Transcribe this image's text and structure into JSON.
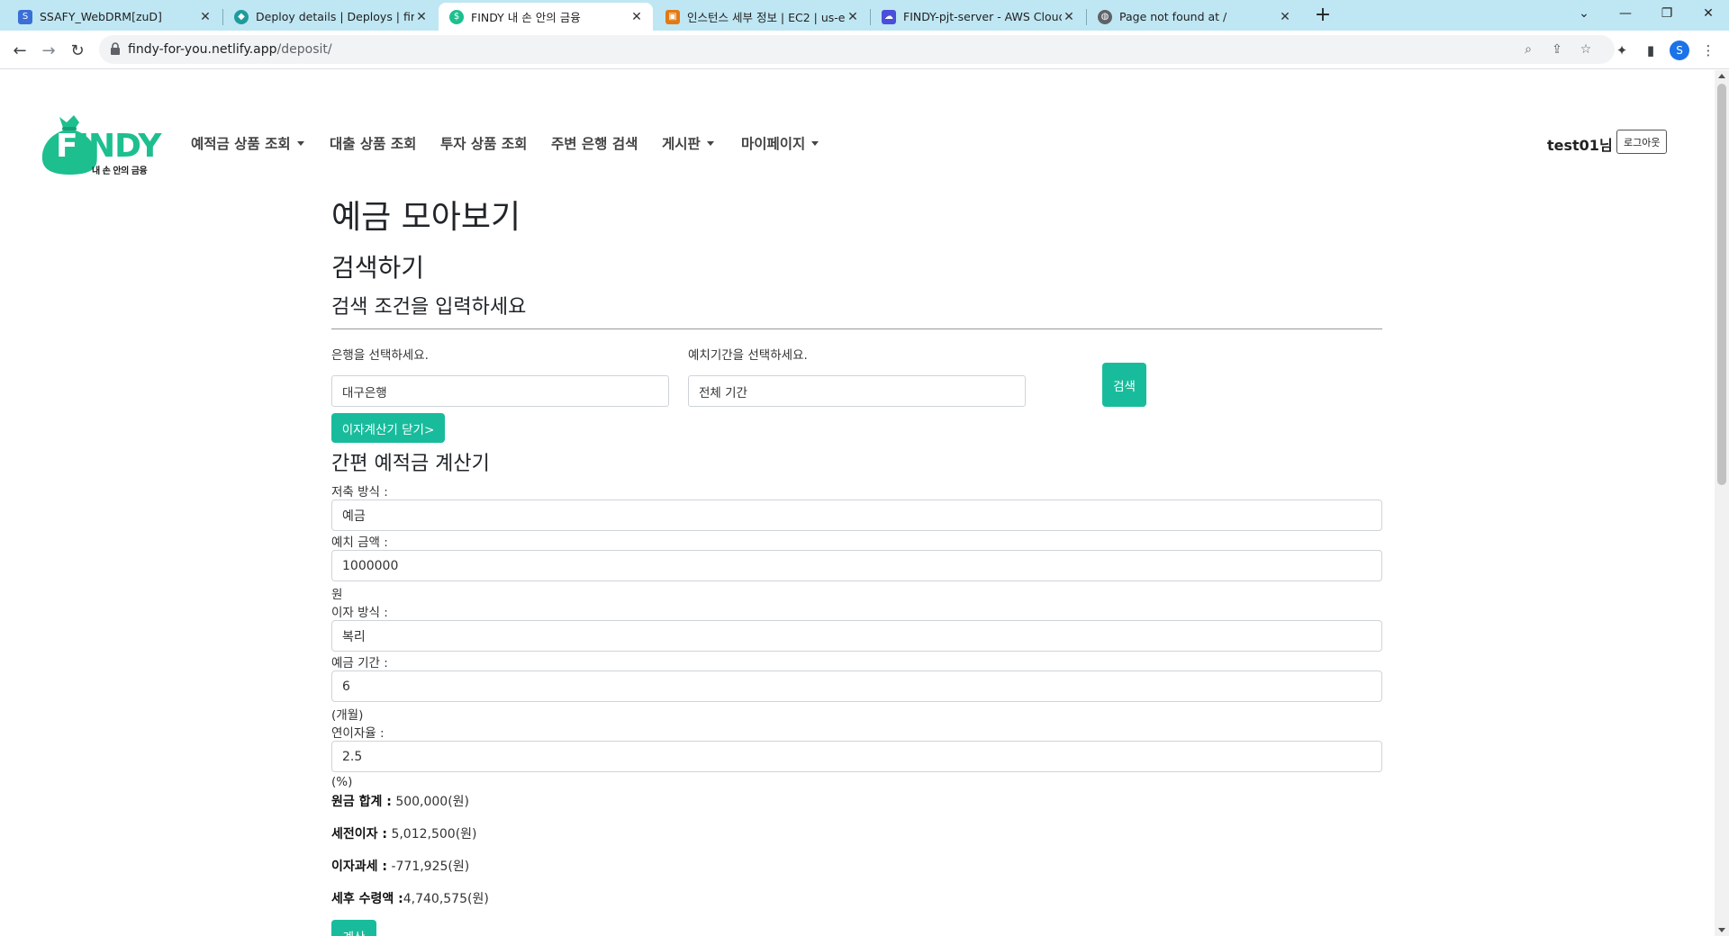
{
  "browser": {
    "tabs": [
      {
        "title": "SSAFY_WebDRM[zuD]",
        "favicon": "ssafy-icon"
      },
      {
        "title": "Deploy details | Deploys | findy",
        "favicon": "netlify-icon"
      },
      {
        "title": "FINDY 내 손 안의 금융",
        "favicon": "findy-bag-icon"
      },
      {
        "title": "인스턴스 세부 정보 | EC2 | us-e",
        "favicon": "aws-ec2-icon"
      },
      {
        "title": "FINDY-pjt-server - AWS Cloud9",
        "favicon": "aws-cloud9-icon"
      },
      {
        "title": "Page not found at /",
        "favicon": "globe-icon"
      }
    ],
    "url_host": "findy-for-you.netlify.app",
    "url_path": "/deposit/",
    "profile_initial": "S"
  },
  "site": {
    "logo_text": "FINDY",
    "logo_subtext": "내 손 안의 금융",
    "brand_color": "#18bc9c",
    "nav": [
      {
        "label": "예적금 상품 조회",
        "dropdown": true
      },
      {
        "label": "대출 상품 조회",
        "dropdown": false
      },
      {
        "label": "투자 상품 조회",
        "dropdown": false
      },
      {
        "label": "주변 은행 검색",
        "dropdown": false
      },
      {
        "label": "게시판",
        "dropdown": true
      },
      {
        "label": "마이페이지",
        "dropdown": true
      }
    ],
    "username": "test01님",
    "logout_label": "로그아웃"
  },
  "page": {
    "title": "예금 모아보기",
    "search_heading": "검색하기",
    "search_subheading": "검색 조건을 입력하세요",
    "bank_label": "은행을 선택하세요.",
    "bank_value": "대구은행",
    "period_label": "예치기간을 선택하세요.",
    "period_value": "전체 기간",
    "search_button": "검색",
    "toggle_calc_button": "이자계산기 닫기>"
  },
  "calculator": {
    "heading": "간편 예적금 계산기",
    "savings_type_label": "저축 방식 :",
    "savings_type_value": "예금",
    "amount_label": "예치 금액 :",
    "amount_value": "1000000",
    "amount_unit": "원",
    "interest_type_label": "이자 방식 :",
    "interest_type_value": "복리",
    "period_label": "예금 기간 :",
    "period_value": "6",
    "period_unit": "(개월)",
    "rate_label": "연이자율 :",
    "rate_value": "2.5",
    "rate_unit": "(%)",
    "principal_label": "원금 합계 :",
    "principal_value": " 500,000(원)",
    "pretax_label": "세전이자 :",
    "pretax_value": " 5,012,500(원)",
    "tax_label": "이자과세 :",
    "tax_value": " -771,925(원)",
    "aftertax_label": "세후 수령액 :",
    "aftertax_value": "4,740,575(원)",
    "calc_button": "계산"
  }
}
